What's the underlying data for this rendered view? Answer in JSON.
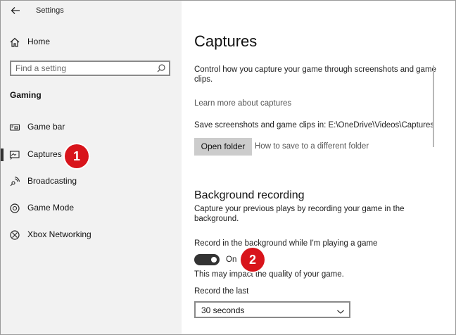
{
  "window": {
    "title": "Settings",
    "controls": [
      "minimize-icon",
      "maximize-icon",
      "close-icon"
    ]
  },
  "sidebar": {
    "home_label": "Home",
    "search_placeholder": "Find a setting",
    "section_title": "Gaming",
    "items": [
      {
        "label": "Game bar",
        "icon": "game-bar-icon",
        "selected": false
      },
      {
        "label": "Captures",
        "icon": "captures-icon",
        "selected": true
      },
      {
        "label": "Broadcasting",
        "icon": "broadcasting-icon",
        "selected": false
      },
      {
        "label": "Game Mode",
        "icon": "game-mode-icon",
        "selected": false
      },
      {
        "label": "Xbox Networking",
        "icon": "xbox-icon",
        "selected": false
      }
    ]
  },
  "annotations": {
    "badge1": "1",
    "badge2": "2",
    "badge_color": "#d8141b"
  },
  "main": {
    "title": "Captures",
    "description_line1": "Control how you capture your game through screenshots and game",
    "description_line2": "clips.",
    "learn_more": "Learn more about captures",
    "save_location": "Save screenshots and game clips in: E:\\OneDrive\\Videos\\Captures",
    "open_folder_label": "Open folder",
    "different_folder_link": "How to save to a different folder",
    "bg_recording": {
      "title": "Background recording",
      "description_line1": "Capture your previous plays by recording your game in the",
      "description_line2": "background.",
      "toggle_label": "Record in the background while I'm playing a game",
      "toggle_state": "On",
      "toggle_on": true,
      "impact_note": "This may impact the quality of your game.",
      "record_last_label": "Record the last",
      "record_last_value": "30 seconds"
    }
  }
}
